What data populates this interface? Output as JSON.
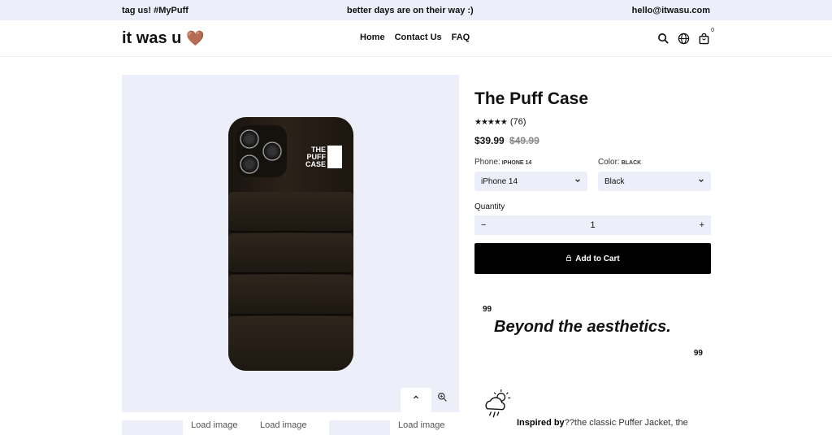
{
  "announcement": {
    "left": "tag us! #MyPuff",
    "center": "better days are on their way :)",
    "right": "hello@itwasu.com"
  },
  "header": {
    "logo": "it was u",
    "logo_emoji": "🤎",
    "nav": [
      "Home",
      "Contact Us",
      "FAQ"
    ],
    "cart_count": "0",
    "icons": [
      "search-icon",
      "globe-icon",
      "cart-icon"
    ]
  },
  "gallery": {
    "brand_text_line1": "THE",
    "brand_text_line2": "PUFF",
    "brand_text_line3": "CASE",
    "up_glyph": "⌃",
    "thumbnails": [
      "",
      "Load image",
      "Load image",
      "",
      "Load image"
    ]
  },
  "product": {
    "title": "The Puff Case",
    "stars": "★★★★★",
    "reviews": "(76)",
    "price": "$39.99",
    "compare_price": "$49.99",
    "phone_label": "Phone:",
    "phone_value": "iPhone 14",
    "phone_selected": "iPhone 14",
    "color_label": "Color:",
    "color_value": "Black",
    "color_selected": "Black",
    "quantity_label": "Quantity",
    "quantity": "1",
    "minus": "−",
    "plus": "+",
    "add_to_cart": "Add to Cart"
  },
  "quote": {
    "open_mark": "99",
    "text": "Beyond the aesthetics.",
    "close_mark": "99"
  },
  "description": {
    "inspired_bold": "Inspired by",
    "inspired_rest": "??the classic Puffer Jacket, the"
  },
  "colors": {
    "panel_bg": "#eceff9",
    "button_bg": "#000000",
    "heart": "#7b4a24"
  }
}
